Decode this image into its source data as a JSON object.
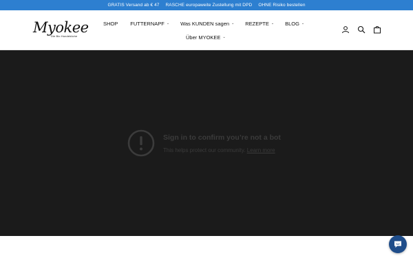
{
  "announcement": {
    "items": [
      "GRATIS Versand ab € 47",
      "RASCHE europaweite Zustellung mit DPD",
      "OHNE Risiko bestellen"
    ]
  },
  "header": {
    "logo": {
      "word": "Myokee",
      "tagline": "Die Bio Hundeküche"
    },
    "nav": [
      {
        "label": "SHOP"
      },
      {
        "label": "FUTTERNAPF"
      },
      {
        "label": "Was KUNDEN sagen"
      },
      {
        "label": "REZEPTE"
      },
      {
        "label": "BLOG"
      },
      {
        "label": "Über MYOKEE"
      }
    ],
    "icons": [
      "account-icon",
      "search-icon",
      "cart-icon"
    ]
  },
  "video": {
    "title": "Sign in to confirm you’re not a bot",
    "subtitle": "This helps protect our community.",
    "link": "Learn more",
    "icon": "exclamation-circle-icon"
  },
  "chat": {
    "icon": "chat-bubble-icon"
  },
  "colors": {
    "announcement_bg": "#2d7fd0",
    "video_bg": "#1b1b1b",
    "chat_bg": "#1f4d8a"
  }
}
